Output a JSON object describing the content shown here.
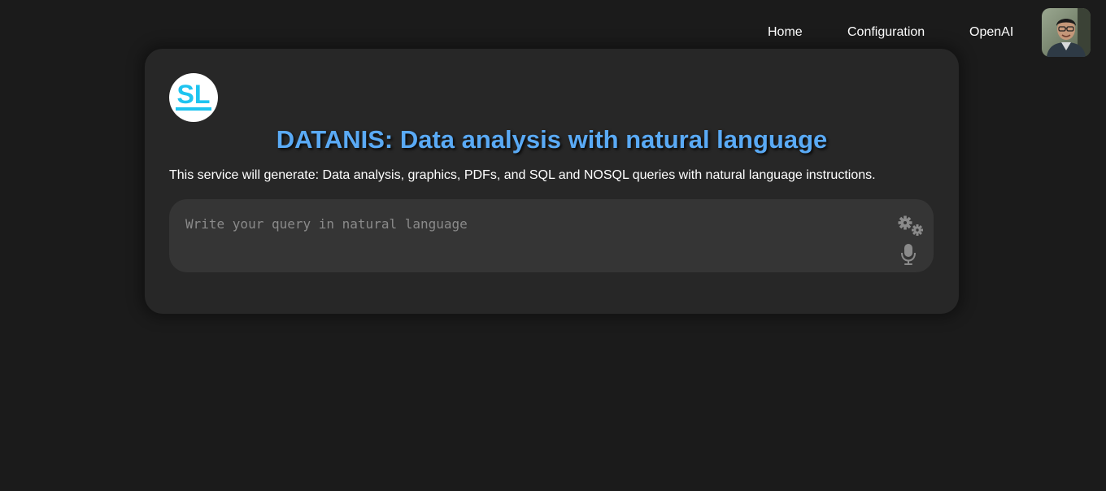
{
  "nav": {
    "items": [
      {
        "label": "Home"
      },
      {
        "label": "Configuration"
      },
      {
        "label": "OpenAI"
      }
    ],
    "avatar_icon": "user-avatar-photo"
  },
  "card": {
    "logo_text": "SL",
    "logo_color": "#1ec4f0",
    "title": "DATANIS: Data analysis with natural language",
    "title_color": "#5aaaf5",
    "subtitle": "This service will generate: Data analysis, graphics, PDFs, and SQL and NOSQL queries with natural language instructions.",
    "query": {
      "value": "",
      "placeholder": "Write your query in natural language",
      "settings_icon": "gears-icon",
      "voice_icon": "microphone-icon"
    }
  }
}
